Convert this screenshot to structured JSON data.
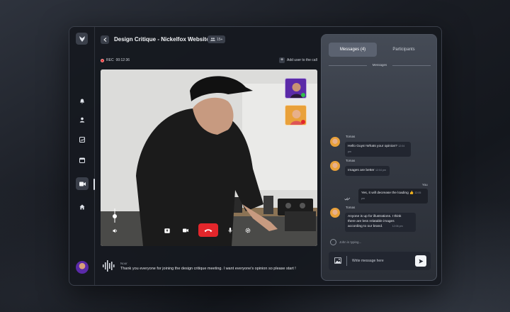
{
  "call": {
    "title": "Design Critique - Nickelfox Website",
    "participants_badge": "15+",
    "rec_label": "REC",
    "rec_time": "00:12:36",
    "add_user_label": "Add user to the call"
  },
  "caption": {
    "speaker": "Noor",
    "text": "Thank you everyone for joining the design critique meeting. I want everyone's opinion so please start !"
  },
  "chat": {
    "tab_messages": "Messages (4)",
    "tab_participants": "Participants",
    "section_label": "Messages",
    "messages": [
      {
        "name": "Tomas",
        "text": "Hello Guys! Whats your opinion?",
        "time": "12:04 pm"
      },
      {
        "name": "Tomas",
        "text": "Images are better",
        "time": "12:04 pm"
      },
      {
        "name": "You",
        "text": "Yes, it will decrease the loading",
        "emoji": "👍",
        "time": "12:05 pm"
      },
      {
        "name": "Tomas",
        "text_lines": [
          "Anyone is up for illustrations. I think",
          "there are less relatable images",
          "according to our brand."
        ],
        "time": "12:06 pm"
      }
    ],
    "typing_text": "John is typing...",
    "composer_placeholder": "Write message here"
  },
  "colors": {
    "end_call": "#e3262b",
    "accent_online": "#2fbf4a",
    "accent_offline": "#e3262b"
  }
}
